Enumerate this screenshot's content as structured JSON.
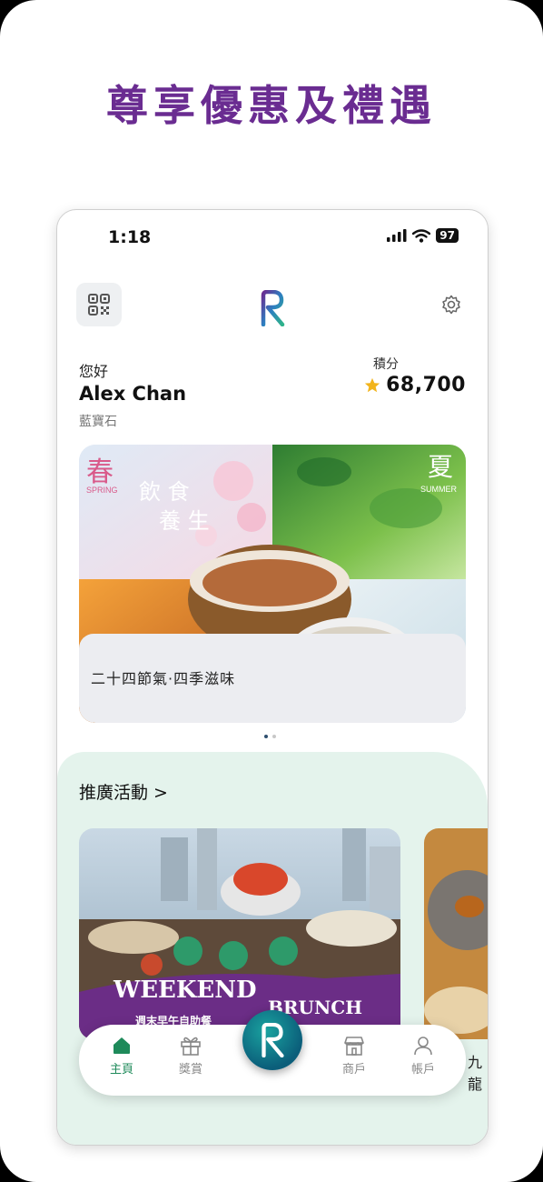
{
  "headline": "尊享優惠及禮遇",
  "status_bar": {
    "time": "1:18",
    "battery": "97"
  },
  "header": {
    "greeting": "您好",
    "user_name": "Alex Chan",
    "tier": "藍寶石",
    "points_label": "積分",
    "points_value": "68,700"
  },
  "banner": {
    "caption": "二十四節氣·四季滋味",
    "art_text": {
      "spring": "春",
      "spring_en": "SPRING",
      "summer": "夏",
      "summer_en": "SUMMER",
      "title_1": "飲 食",
      "title_2": "養 生"
    },
    "page_count": 2,
    "active_page": 1
  },
  "promotions": {
    "title": "推廣活動 >",
    "cards": [
      {
        "art_text": {
          "main": "WEEKEND",
          "sub": "BRUNCH",
          "zh": "週末早午自助餐"
        }
      },
      {
        "label": "九龍"
      }
    ]
  },
  "nav": {
    "items": [
      {
        "label": "主頁",
        "icon": "home-icon",
        "active": true
      },
      {
        "label": "獎賞",
        "icon": "gift-icon",
        "active": false
      },
      {
        "label": "商戶",
        "icon": "store-icon",
        "active": false
      },
      {
        "label": "帳戶",
        "icon": "person-icon",
        "active": false
      }
    ]
  },
  "colors": {
    "headline": "#6a2c91",
    "accent_green": "#1e8a5a",
    "promo_bg": "#e4f3ec"
  }
}
